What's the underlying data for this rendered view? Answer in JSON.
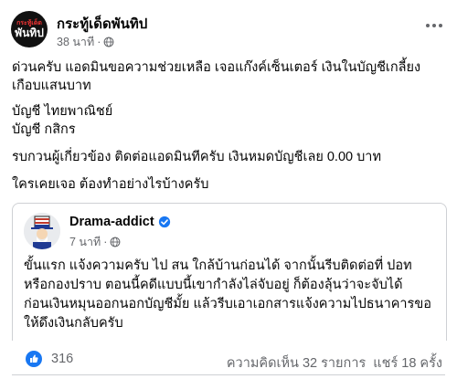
{
  "post": {
    "page_name": "กระทู้เด็ดพันทิป",
    "avatar_text_top": "กระทู้เด็ด",
    "avatar_text_main": "พันทิป",
    "time": "38 นาที",
    "separator": "·",
    "body_lines": [
      "ด่วนครับ แอดมินขอความช่วยเหลือ เจอแก๊งค์เซ็นเตอร์ เงินในบัญชีเกลี้ยง",
      "เกือบแสนบาท",
      "บัญชี ไทยพาณิชย์",
      "บัญชี กสิกร",
      "รบกวนผู้เกี่ยวข้อง ติดต่อแอดมินทีครับ เงินหมดบัญชีเลย 0.00 บาท",
      "ใครเคยเจอ ต้องทำอย่างไรบ้างครับ"
    ]
  },
  "shared": {
    "page_name": "Drama-addict",
    "time": "7 นาที",
    "separator": "·",
    "text_lines": [
      "ขั้นแรก แจ้งความครับ ไป สน ใกล้บ้านก่อนได้ จากนั้นรีบติดต่อที่ ปอท",
      "หรือกองปราบ ตอนนี้คดีแบบนี้เขากำลังไล่จับอยู่ ก็ต้องลุ้นว่าจะจับได้",
      "ก่อนเงินหมุนออกนอกบัญชีมั้ย แล้วรีบเอาเอกสารแจ้งความไปธนาคารขอ",
      "ให้ดึงเงินกลับครับ"
    ]
  },
  "footer": {
    "reaction_count": "316",
    "comments": "ความคิดเห็น 32 รายการ",
    "shares": "แชร์ 18 ครั้ง"
  },
  "colors": {
    "like_blue": "#1877f2",
    "meta_gray": "#65676b",
    "verified_blue": "#1877f2"
  },
  "icons": {
    "globe": "globe-icon",
    "verified": "verified-badge-icon",
    "like": "like-icon",
    "more": "more-dots-icon"
  }
}
